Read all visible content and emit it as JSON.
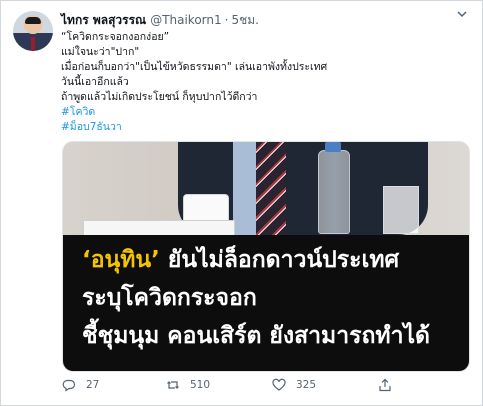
{
  "tweet": {
    "author_name": "ไทกร พลสุวรรณ",
    "handle": "@Thaikorn1",
    "separator": "·",
    "time": "5ชม.",
    "lines": [
      "“โควิดกระจอกงอกง่อย”",
      "แม่ใจนะว่า\"ปาก\"",
      "เมื่อก่อนก็บอกว่า\"เป็นไข้หวัดธรรมดา\" เล่นเอาพังทั้งประเทศ",
      "วันนี้เอาอีกแล้ว",
      "ถ้าพูดแล้วไม่เกิดประโยชน์ ก็หุบปากไว้ดีกว่า"
    ],
    "hashtags": [
      "#โควิด",
      "#ม็อบ7ธันวา"
    ],
    "media": {
      "headline_quote": "‘อนุทิน’",
      "headline_line1_rest": " ยันไม่ล็อกดาวน์ประเทศ",
      "headline_line2": "ระบุโควิดกระจอก",
      "headline_line3": "ชี้ชุมนุม คอนเสิร์ต ยังสามารถทำได้"
    },
    "actions": {
      "reply_count": "27",
      "retweet_count": "510",
      "like_count": "325"
    }
  },
  "icons": {
    "reply": "reply-icon",
    "retweet": "retweet-icon",
    "like": "heart-icon",
    "share": "share-icon",
    "more": "chevron-down-icon"
  },
  "colors": {
    "link": "#1b95e0",
    "muted": "#536471",
    "headline_accent": "#f5c400"
  }
}
